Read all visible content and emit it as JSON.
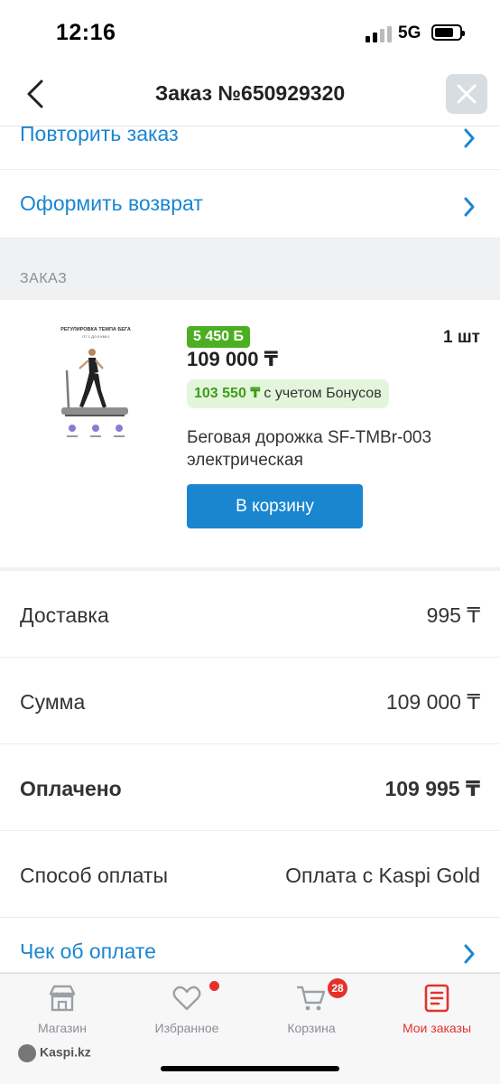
{
  "status_bar": {
    "time": "12:16",
    "network": "5G"
  },
  "header": {
    "title": "Заказ №650929320"
  },
  "links": {
    "repeat_order": "Повторить заказ",
    "return_order": "Оформить возврат",
    "receipt": "Чек об оплате"
  },
  "section": {
    "label": "ЗАКАЗ"
  },
  "product": {
    "bonus_badge": "5 450 Б",
    "price": "109 000 ₸",
    "quantity": "1 шт",
    "bonus_price": "103 550 ₸",
    "bonus_note": "с учетом Бонусов",
    "name": "Беговая дорожка SF-TMBr-003 электрическая",
    "cart_button": "В корзину",
    "image_text": {
      "headline": "РЕГУЛИРОВКА ТЕМПА БЕГА",
      "subline": "ОТ 1 ДО 6 КМ/Ч"
    }
  },
  "summary": [
    {
      "label": "Доставка",
      "value": "995 ₸",
      "bold": false
    },
    {
      "label": "Сумма",
      "value": "109 000 ₸",
      "bold": false
    },
    {
      "label": "Оплачено",
      "value": "109 995 ₸",
      "bold": true
    },
    {
      "label": "Способ оплаты",
      "value": "Оплата с Kaspi Gold",
      "bold": false
    }
  ],
  "tabbar": {
    "tabs": [
      {
        "label": "Магазин",
        "icon": "store-icon",
        "active": false
      },
      {
        "label": "Избранное",
        "icon": "heart-icon",
        "active": false
      },
      {
        "label": "Корзина",
        "icon": "cart-icon",
        "active": false,
        "badge": "28"
      },
      {
        "label": "Мои заказы",
        "icon": "orders-icon",
        "active": true
      }
    ]
  },
  "watermark": "Kaspi.kz",
  "colors": {
    "accent": "#1a86d0",
    "brand_red": "#e3322b",
    "bonus_green": "#4caf23"
  }
}
